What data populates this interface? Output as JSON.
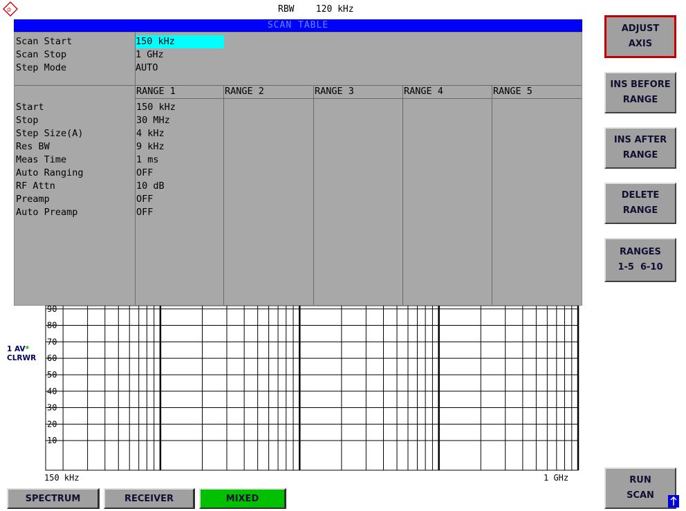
{
  "header": {
    "rbw_label": "RBW",
    "rbw_value": "120 kHz",
    "table_title": "SCAN TABLE"
  },
  "scan": {
    "rows": [
      {
        "label": "Scan Start",
        "value": "150 kHz"
      },
      {
        "label": "Scan Stop",
        "value": "1 GHz"
      },
      {
        "label": "Step Mode",
        "value": "AUTO"
      }
    ]
  },
  "ranges": {
    "headers": [
      "RANGE 1",
      "RANGE 2",
      "RANGE 3",
      "RANGE 4",
      "RANGE 5"
    ],
    "param_labels": [
      "Start",
      "Stop",
      "Step Size(A)",
      "Res BW",
      "Meas Time",
      "Auto Ranging",
      "RF Attn",
      "Preamp",
      "Auto Preamp"
    ],
    "range1_values": [
      "150 kHz",
      "30 MHz",
      "4 kHz",
      "9 kHz",
      "1 ms",
      "OFF",
      "10 dB",
      "OFF",
      "OFF"
    ]
  },
  "trace": {
    "line1": "1 AV",
    "line2": "CLRWR",
    "star": "*"
  },
  "chart_data": {
    "type": "line",
    "title": "",
    "y_tick_labels": [
      "90",
      "80",
      "70",
      "60",
      "50",
      "40",
      "30",
      "20",
      "10"
    ],
    "x_start_label": "150 kHz",
    "x_stop_label": "1 GHz",
    "x_scale": "log",
    "grid": true,
    "series": []
  },
  "softkeys": [
    {
      "label": "ADJUST\nAXIS",
      "active": true
    },
    {
      "label": "INS BEFORE\nRANGE",
      "active": false
    },
    {
      "label": "INS AFTER\nRANGE",
      "active": false
    },
    {
      "label": "DELETE\nRANGE",
      "active": false
    },
    {
      "label": "RANGES\n1-5  6-10",
      "active": false
    },
    {
      "label": "RUN\nSCAN",
      "active": false
    }
  ],
  "tabs": [
    "SPECTRUM",
    "RECEIVER",
    "MIXED"
  ],
  "colors": {
    "header_bg": "#0000ff",
    "highlight": "#00ffff",
    "table_bg": "#a8a8a8",
    "tab_active": "#00c000",
    "softkey_active_border": "#c00000"
  }
}
